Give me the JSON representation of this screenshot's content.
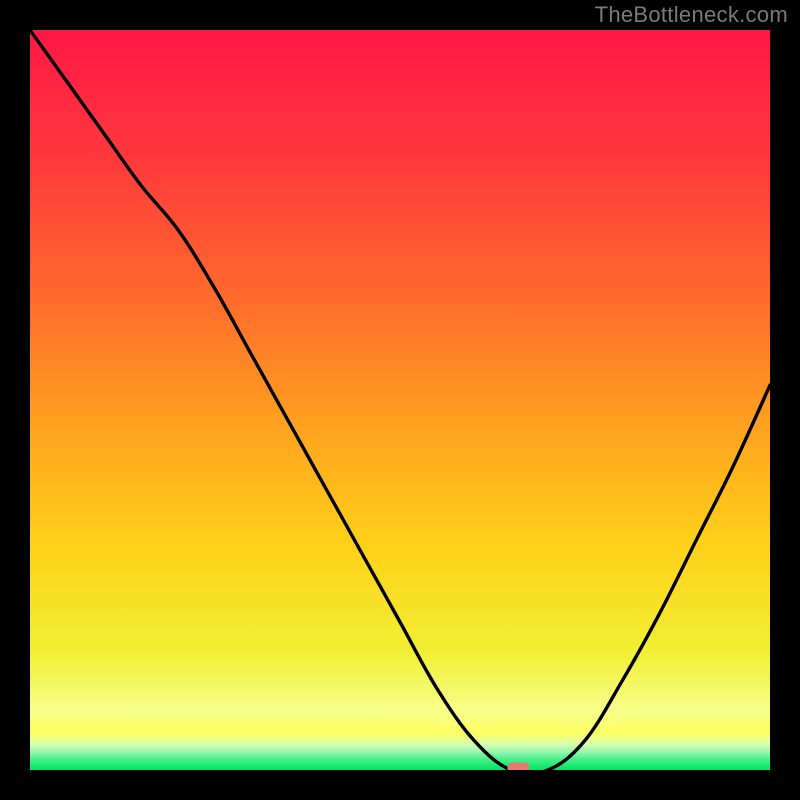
{
  "watermark": "TheBottleneck.com",
  "chart_data": {
    "type": "line",
    "title": "",
    "xlabel": "",
    "ylabel": "",
    "xlim": [
      0,
      100
    ],
    "ylim": [
      0,
      100
    ],
    "grid": false,
    "legend": false,
    "series": [
      {
        "name": "bottleneck-curve",
        "x": [
          0,
          5,
          10,
          15,
          20,
          25,
          30,
          35,
          40,
          45,
          50,
          55,
          60,
          65,
          70,
          75,
          80,
          85,
          90,
          95,
          100
        ],
        "y": [
          100,
          93,
          86,
          79,
          73,
          65,
          56,
          47,
          38,
          29,
          20,
          11,
          4,
          0,
          0,
          4,
          12,
          21,
          31,
          41,
          52
        ]
      }
    ],
    "marker": {
      "x": 66,
      "y": 0
    },
    "bands": [
      {
        "name": "red-top",
        "from": 100,
        "to": 66,
        "color_top": "#ff1846",
        "color_bottom": "#ff6a2c"
      },
      {
        "name": "orange-mid",
        "from": 66,
        "to": 33,
        "color_top": "#ff6a2c",
        "color_bottom": "#ffd21a"
      },
      {
        "name": "yellow-low",
        "from": 33,
        "to": 6,
        "color_top": "#ffd21a",
        "color_bottom": "#f6ff8a"
      },
      {
        "name": "yellow-bright",
        "from": 6,
        "to": 3,
        "color_top": "#fcff60",
        "color_bottom": "#e6ffa0"
      },
      {
        "name": "green-strip",
        "from": 3,
        "to": 0,
        "color_top": "#7cf5a0",
        "color_bottom": "#00e566"
      }
    ]
  }
}
